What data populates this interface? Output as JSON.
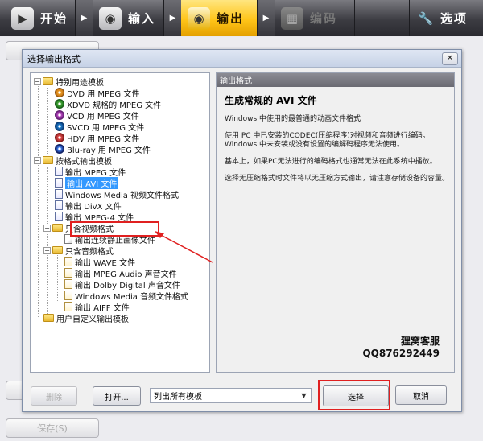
{
  "toolbar": {
    "start": "开始",
    "input": "输入",
    "output": "输出",
    "encode": "编码",
    "options": "选项"
  },
  "background": {
    "save_button": "保存(S)"
  },
  "dialog": {
    "title": "选择输出格式",
    "tree": {
      "special_group": "特别用途模板",
      "special_items": [
        "DVD 用 MPEG 文件",
        "XDVD 规格的 MPEG 文件",
        "VCD 用 MPEG 文件",
        "SVCD 用 MPEG 文件",
        "HDV 用 MPEG 文件",
        "Blu-ray 用 MPEG 文件"
      ],
      "format_group": "按格式输出模板",
      "format_items": [
        "输出 MPEG 文件",
        "输出 AVI 文件",
        "Windows Media 视频文件格式",
        "输出 DivX 文件",
        "输出 MPEG-4 文件"
      ],
      "video_only_group": "只含视频格式",
      "video_only_items": [
        "输出连续静止画像文件"
      ],
      "audio_only_group": "只含音频格式",
      "audio_only_items": [
        "输出 WAVE 文件",
        "输出 MPEG Audio 声音文件",
        "输出 Dolby Digital 声音文件",
        "Windows Media 音频文件格式",
        "输出 AIFF 文件"
      ],
      "user_group": "用户自定义输出模板"
    },
    "info": {
      "header": "输出格式",
      "title": "生成常规的 AVI 文件",
      "paragraphs": [
        "Windows 中使用的最普通的动画文件格式",
        "使用 PC 中已安装的CODEC(压缩程序)对视频和音频进行编码。\nWindows 中未安装或没有设置的编解码程序无法使用。",
        "基本上，如果PC无法进行的编码格式也通常无法在此系统中播放。",
        "选择无压缩格式时文件将以无压缩方式输出，请注意存储设备的容量。"
      ],
      "watermark_line1": "狸窝客服",
      "watermark_line2": "QQ876292449"
    },
    "buttons": {
      "delete": "删除",
      "open": "打开...",
      "select": "选择",
      "cancel": "取消"
    },
    "template_filter": {
      "selected": "列出所有模板"
    }
  },
  "colors": {
    "highlight_red": "#e02020",
    "selection_blue": "#3399ff",
    "toolbar_active": "#ffc418"
  }
}
